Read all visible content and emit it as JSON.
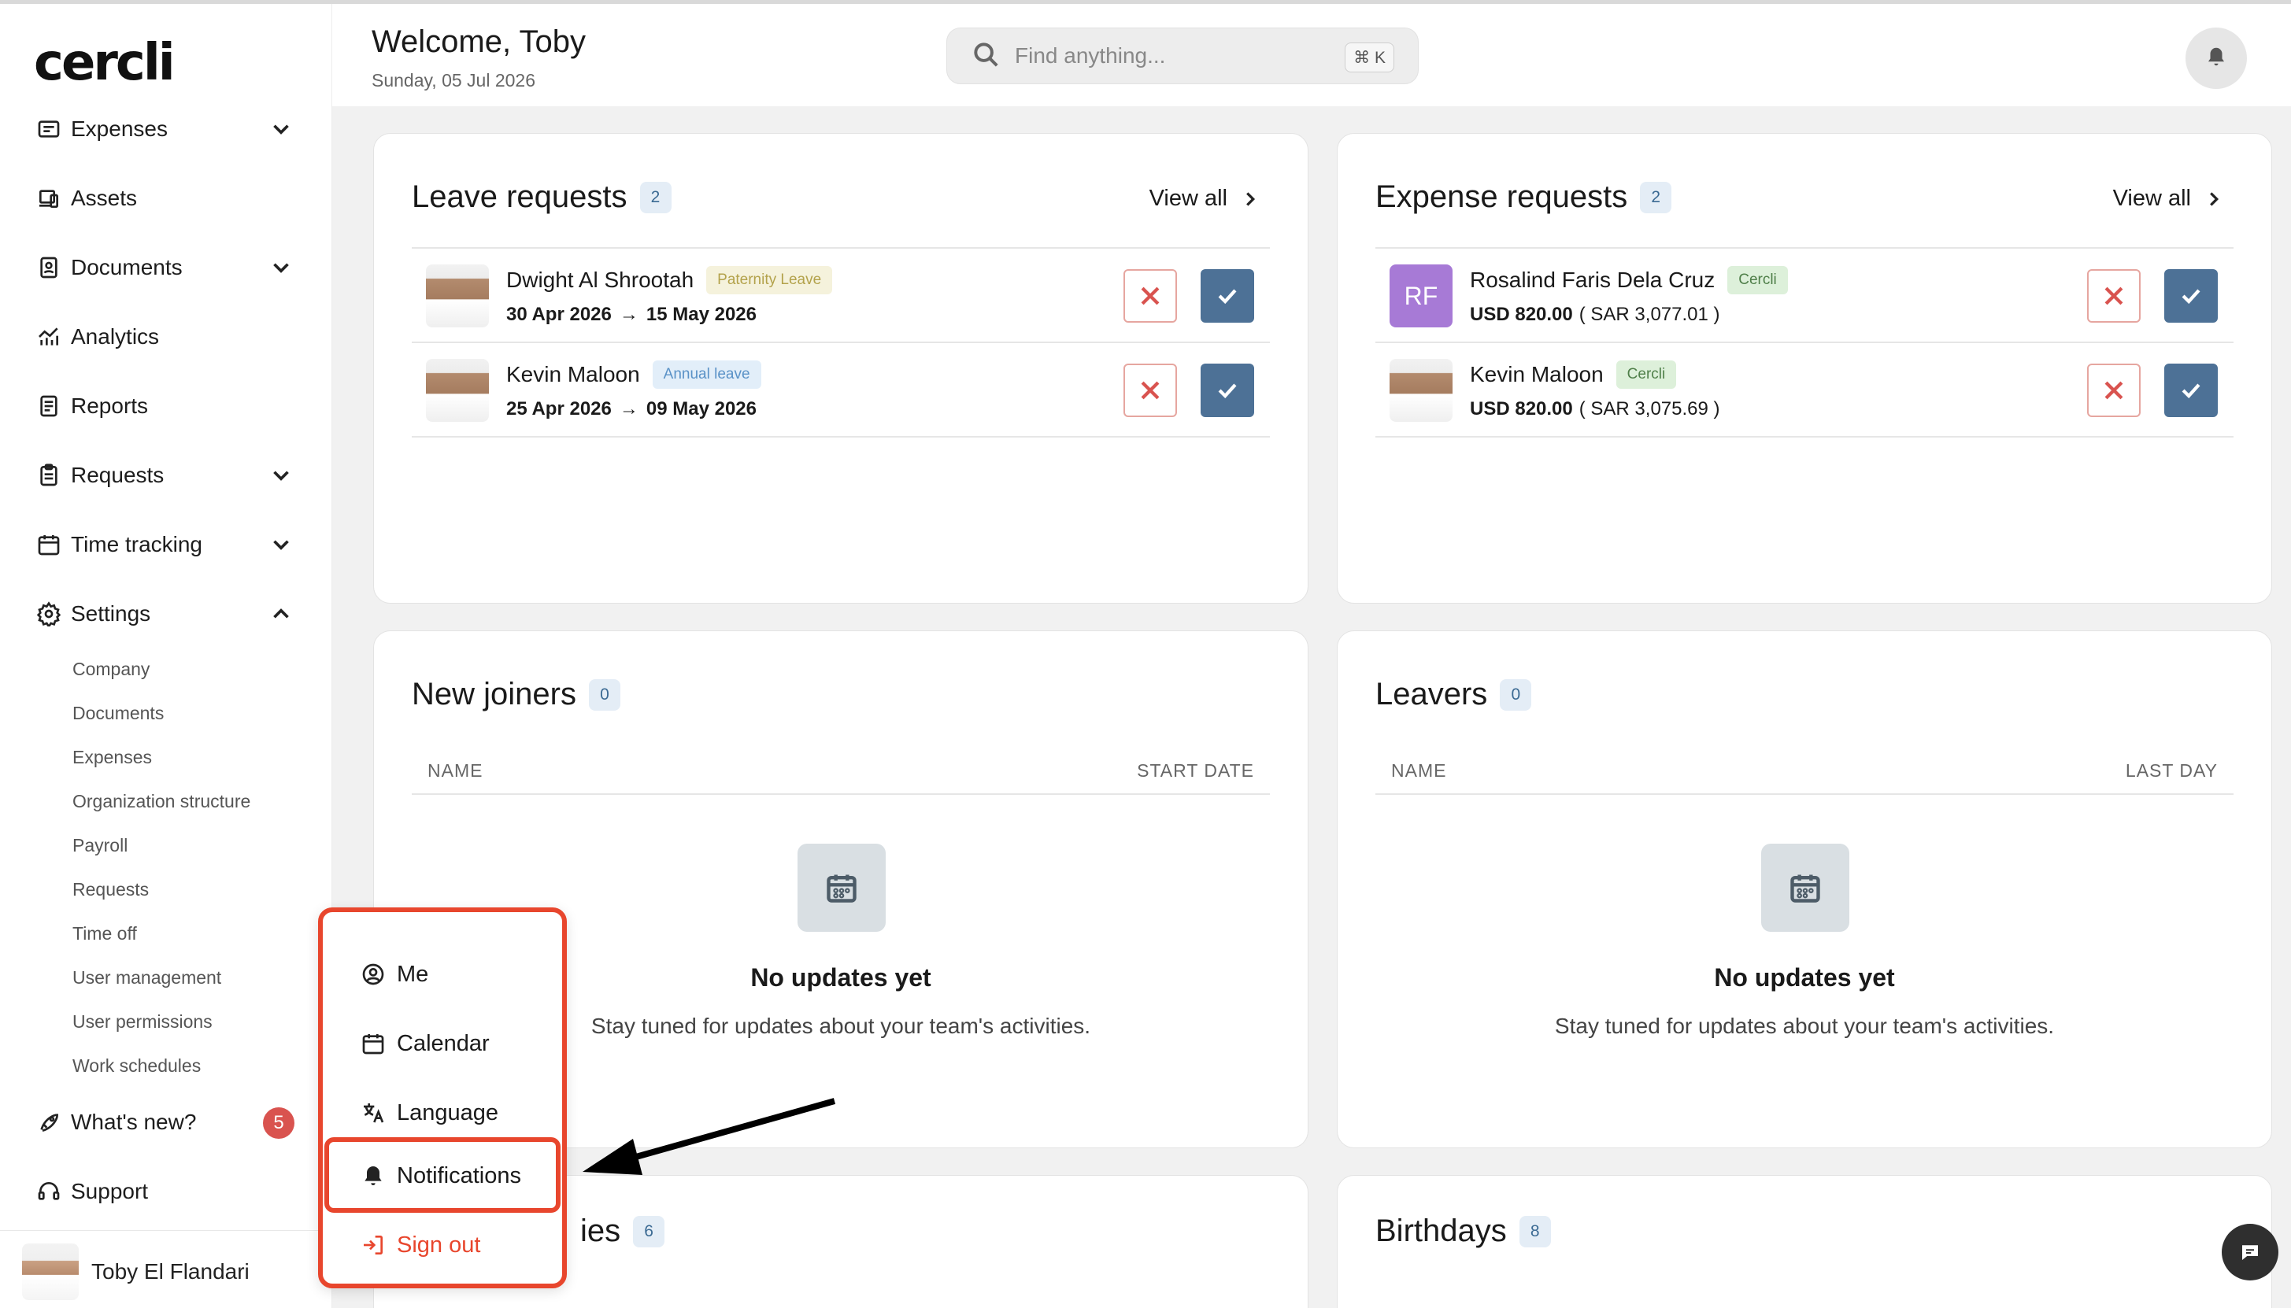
{
  "app": {
    "logo": "cercli"
  },
  "header": {
    "welcome": "Welcome, Toby",
    "date": "Sunday, 05 Jul 2026",
    "search_placeholder": "Find anything...",
    "search_shortcut": "⌘ K"
  },
  "sidebar": {
    "items": [
      {
        "label": "Expenses",
        "icon": "receipt-icon",
        "expandable": true
      },
      {
        "label": "Assets",
        "icon": "laptop-icon"
      },
      {
        "label": "Documents",
        "icon": "document-icon",
        "expandable": true
      },
      {
        "label": "Analytics",
        "icon": "analytics-icon"
      },
      {
        "label": "Reports",
        "icon": "report-icon"
      },
      {
        "label": "Requests",
        "icon": "clipboard-icon",
        "expandable": true
      },
      {
        "label": "Time tracking",
        "icon": "calendar-icon",
        "expandable": true
      },
      {
        "label": "Settings",
        "icon": "gear-icon",
        "expanded": true
      }
    ],
    "settings_sub": [
      "Company",
      "Documents",
      "Expenses",
      "Organization structure",
      "Payroll",
      "Requests",
      "Time off",
      "User management",
      "User permissions",
      "Work schedules"
    ],
    "whats_new": {
      "label": "What's new?",
      "count": "5"
    },
    "support": "Support",
    "user_name": "Toby El Flandari"
  },
  "leave_requests": {
    "title": "Leave requests",
    "count": "2",
    "view_all": "View all",
    "rows": [
      {
        "name": "Dwight Al Shrootah",
        "tag": "Paternity Leave",
        "from": "30 Apr 2026",
        "to": "15 May 2026"
      },
      {
        "name": "Kevin Maloon",
        "tag": "Annual leave",
        "from": "25 Apr 2026",
        "to": "09 May 2026"
      }
    ]
  },
  "expense_requests": {
    "title": "Expense requests",
    "count": "2",
    "view_all": "View all",
    "rows": [
      {
        "name": "Rosalind Faris Dela Cruz",
        "initials": "RF",
        "tag": "Cercli",
        "amount": "USD 820.00",
        "converted": "( SAR 3,077.01 )"
      },
      {
        "name": "Kevin Maloon",
        "tag": "Cercli",
        "amount": "USD 820.00",
        "converted": "( SAR 3,075.69 )"
      }
    ]
  },
  "new_joiners": {
    "title": "New joiners",
    "count": "0",
    "col_left": "NAME",
    "col_right": "START DATE",
    "empty_title": "No updates yet",
    "empty_sub": "Stay tuned for updates about your team's activities."
  },
  "leavers": {
    "title": "Leavers",
    "count": "0",
    "col_left": "NAME",
    "col_right": "LAST DAY",
    "empty_title": "No updates yet",
    "empty_sub": "Stay tuned for updates about your team's activities."
  },
  "anniversaries": {
    "title_visible": "ies",
    "count": "6"
  },
  "birthdays": {
    "title": "Birthdays",
    "count": "8"
  },
  "user_menu": {
    "items": [
      "Me",
      "Calendar",
      "Language",
      "Notifications",
      "Sign out"
    ]
  },
  "colors": {
    "accent": "#4d7196",
    "danger": "#d9534f",
    "highlight": "#e8462d"
  }
}
